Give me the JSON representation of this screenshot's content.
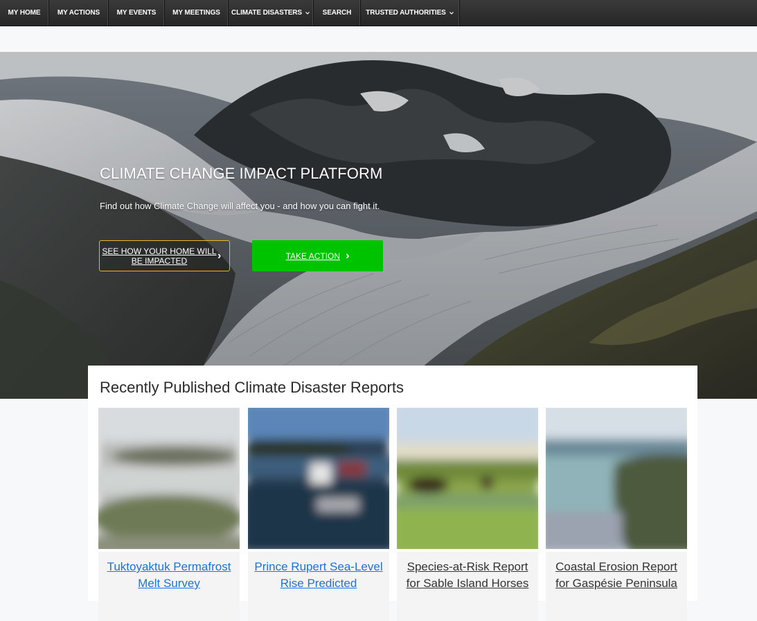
{
  "nav": {
    "items": [
      {
        "label": "MY HOME",
        "dropdown": false
      },
      {
        "label": "MY ACTIONS",
        "dropdown": false
      },
      {
        "label": "MY EVENTS",
        "dropdown": false
      },
      {
        "label": "MY MEETINGS",
        "dropdown": false
      },
      {
        "label": "CLIMATE DISASTERS",
        "dropdown": true
      },
      {
        "label": "SEARCH",
        "dropdown": false
      },
      {
        "label": "TRUSTED AUTHORITIES",
        "dropdown": true
      }
    ]
  },
  "hero": {
    "title": "CLIMATE CHANGE IMPACT PLATFORM",
    "subtitle": "Find out how Climate Change will affect you - and how you can fight it.",
    "secondary_button": "SEE HOW YOUR HOME WILL BE IMPACTED",
    "primary_button": "TAKE ACTION",
    "chevron": "›"
  },
  "reports": {
    "title": "Recently Published Climate Disaster Reports",
    "cards": [
      {
        "caption": "Tuktoyaktuk Permafrost Melt Survey",
        "style": "link"
      },
      {
        "caption": "Prince Rupert Sea-Level Rise Predicted",
        "style": "link"
      },
      {
        "caption": "Species-at-Risk Report for Sable Island Horses",
        "style": "dark"
      },
      {
        "caption": "Coastal Erosion Report for Gaspésie Peninsula",
        "style": "dark"
      }
    ]
  },
  "colors": {
    "accent_green": "#00c300",
    "outline_gold": "#f0b429",
    "link_blue": "#1a73d9"
  }
}
